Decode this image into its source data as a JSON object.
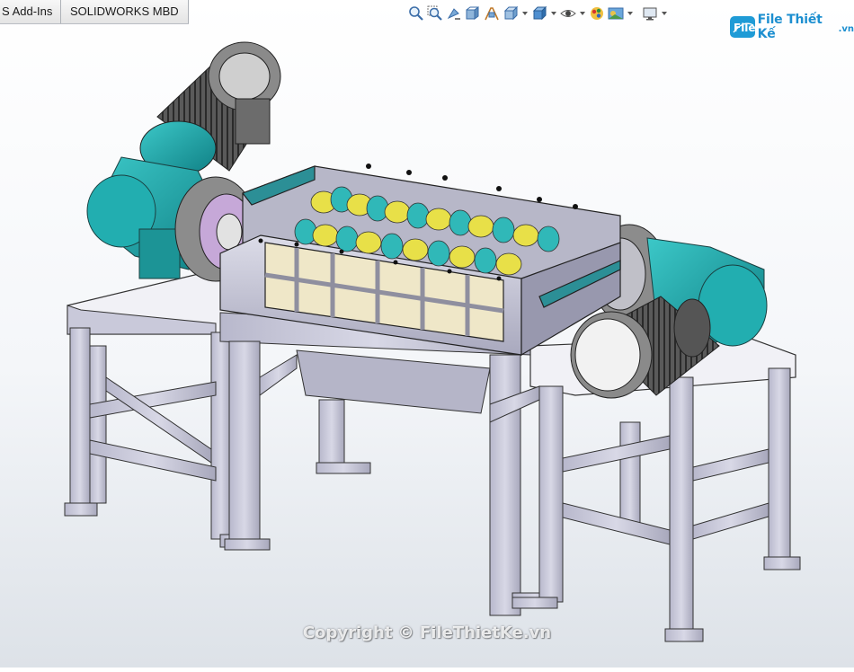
{
  "tabs": [
    {
      "label": "S Add-Ins",
      "active": false
    },
    {
      "label": "SOLIDWORKS MBD",
      "active": false
    }
  ],
  "heads_up_toolbar": {
    "icons": [
      "zoom-to-fit-icon",
      "zoom-to-area-icon",
      "previous-view-icon",
      "section-view-icon",
      "dynamic-annotation-views-icon",
      "view-orientation-icon",
      "display-style-icon",
      "hide-show-items-icon",
      "edit-appearance-icon",
      "apply-scene-icon",
      "view-settings-icon"
    ]
  },
  "logo": {
    "brand": "File Thiết Kế",
    "domain": ".vn",
    "colors": {
      "brand": "#1d8fd0"
    }
  },
  "watermark": {
    "text": "Copyright © FileThietKe.vn"
  },
  "model": {
    "description": "shredder-assembly",
    "colors": {
      "frame": "#c4c4d4",
      "teal_gearbox": "#1aa6a6",
      "blade_yellow": "#e8e048",
      "blade_teal": "#30b8b8",
      "motor_grey": "#6c6c6c",
      "screen_beige": "#efe7c8"
    }
  }
}
